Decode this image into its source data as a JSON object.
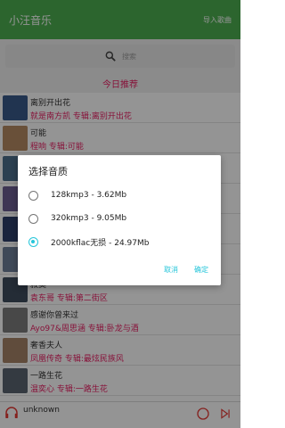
{
  "header": {
    "title": "小汪音乐",
    "action": "导入歌曲"
  },
  "search": {
    "placeholder": "搜索"
  },
  "section": {
    "title": "今日推荐"
  },
  "list": [
    {
      "title": "离别开出花",
      "meta": "就是南方凯  专辑:离别开出花",
      "thumb_color": "#3a5b8a"
    },
    {
      "title": "可能",
      "meta": "程响  专辑:可能",
      "thumb_color": "#b58a62"
    },
    {
      "title": "",
      "meta": "",
      "thumb_color": "#4d6e8c"
    },
    {
      "title": "",
      "meta": "",
      "thumb_color": "#6b5e91"
    },
    {
      "title": "",
      "meta": "",
      "thumb_color": "#2e3f6a"
    },
    {
      "title": "",
      "meta": "",
      "thumb_color": "#6d7f98"
    },
    {
      "title": "寂寞",
      "meta": "袁东哥  专辑:第二街区",
      "thumb_color": "#3e4c5e"
    },
    {
      "title": "感谢你曾来过",
      "meta": "Ayo97&周思涵  专辑:卧龙与酒",
      "thumb_color": "#7c7c7c"
    },
    {
      "title": "奢香夫人",
      "meta": "凤凰传奇  专辑:最炫民族风",
      "thumb_color": "#a58368"
    },
    {
      "title": "一路生花",
      "meta": "温奕心  专辑:一路生花",
      "thumb_color": "#5b6570"
    }
  ],
  "player": {
    "song": "unknown"
  },
  "dialog": {
    "title": "选择音质",
    "options": [
      "128kmp3 - 3.62Mb",
      "320kmp3 - 9.05Mb",
      "2000kflac无损 - 24.97Mb"
    ],
    "selected_index": 2,
    "cancel_label": "取消",
    "ok_label": "确定"
  },
  "colors": {
    "primary": "#4caf50",
    "accent": "#e91e63",
    "dialog_accent": "#26c6da"
  }
}
